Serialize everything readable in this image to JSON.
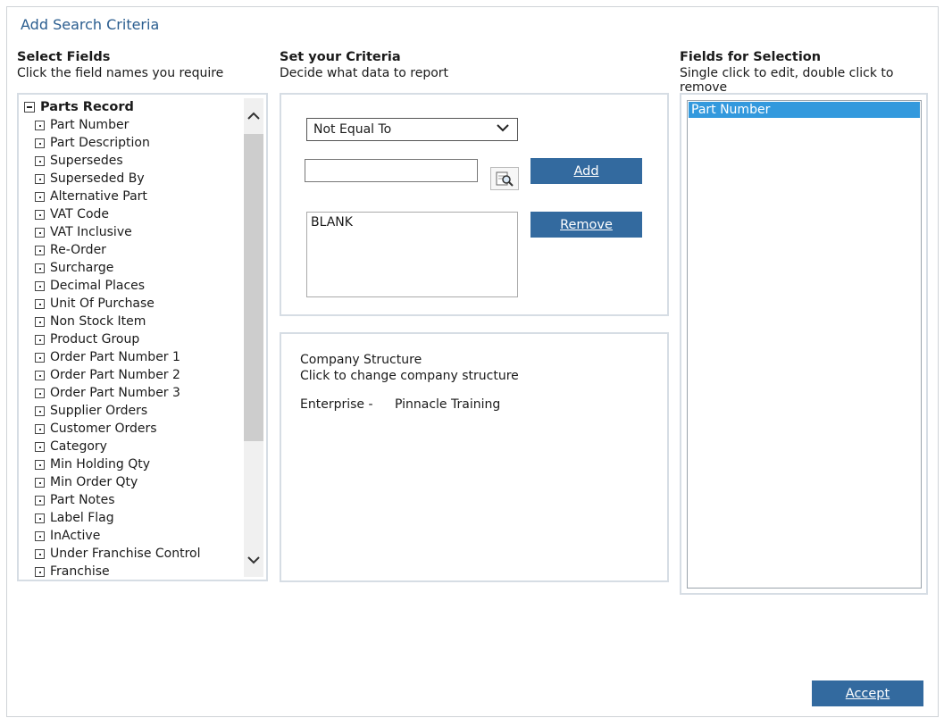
{
  "dialog": {
    "title": "Add Search Criteria"
  },
  "select_fields": {
    "heading": "Select Fields",
    "subheading": "Click the field names you require",
    "root_label": "Parts Record",
    "items": [
      "Part Number",
      "Part Description",
      "Supersedes",
      "Superseded By",
      "Alternative Part",
      "VAT Code",
      "VAT Inclusive",
      "Re-Order",
      "Surcharge",
      "Decimal Places",
      "Unit Of Purchase",
      "Non Stock Item",
      "Product Group",
      "Order Part Number 1",
      "Order Part Number 2",
      "Order Part Number 3",
      "Supplier Orders",
      "Customer Orders",
      "Category",
      "Min Holding Qty",
      "Min Order Qty",
      "Part Notes",
      "Label Flag",
      "InActive",
      "Under Franchise Control",
      "Franchise"
    ]
  },
  "criteria": {
    "heading": "Set your Criteria",
    "subheading": "Decide what data to report",
    "operator_selected": "Not Equal To",
    "value_input": "",
    "add_label": "Add",
    "remove_label": "Remove",
    "values": [
      "BLANK"
    ]
  },
  "company": {
    "heading": "Company Structure",
    "subheading": "Click to change company structure",
    "enterprise_label": "Enterprise -",
    "enterprise_value": "Pinnacle Training"
  },
  "fields_for_selection": {
    "heading": "Fields for Selection",
    "subheading": "Single click to edit, double click to remove",
    "items": [
      "Part Number"
    ]
  },
  "accept_label": "Accept"
}
